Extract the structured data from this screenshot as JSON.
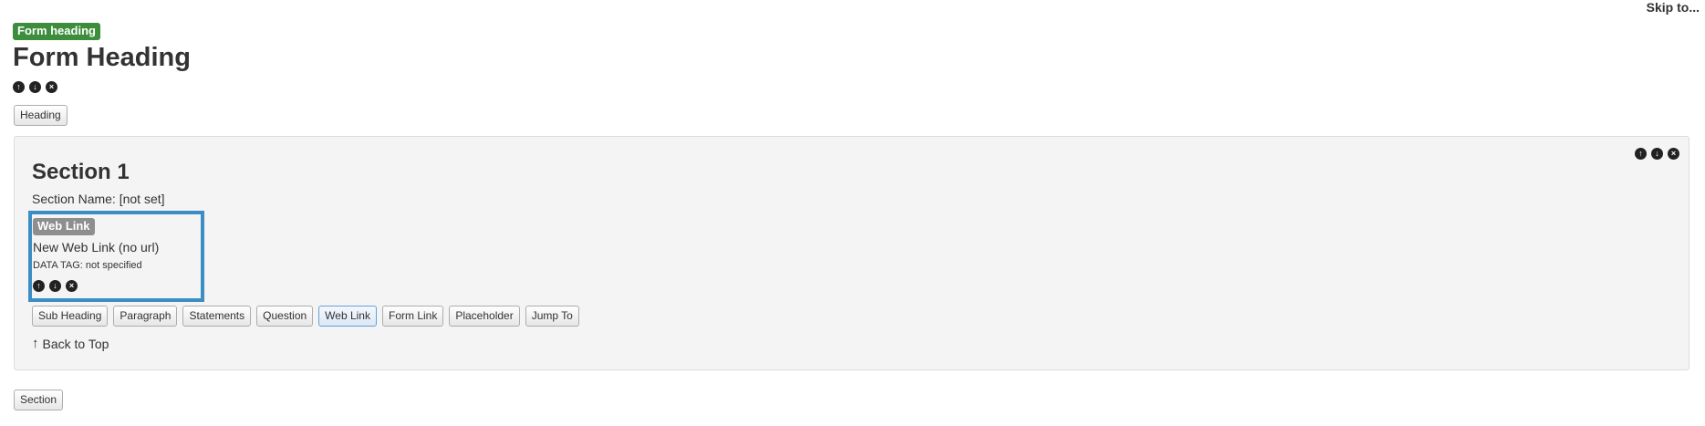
{
  "skip_link": "Skip to...",
  "form": {
    "badge": "Form heading",
    "title": "Form Heading",
    "heading_button": "Heading"
  },
  "section": {
    "title": "Section 1",
    "name_line": "Section Name: [not set]",
    "web_link": {
      "badge": "Web Link",
      "name": "New Web Link (no url)",
      "data_tag": "DATA TAG: not specified"
    },
    "toolbar": [
      "Sub Heading",
      "Paragraph",
      "Statements",
      "Question",
      "Web Link",
      "Form Link",
      "Placeholder",
      "Jump To"
    ],
    "active_tool": "Web Link",
    "back_to_top": "Back to Top"
  },
  "section_button": "Section",
  "icons": {
    "up": "arrow-up-icon",
    "down": "arrow-down-icon",
    "delete": "delete-icon"
  },
  "colors": {
    "green_badge": "#3c8d3c",
    "grey_badge": "#8e8e8e",
    "highlight_border": "#3c8dc4"
  }
}
